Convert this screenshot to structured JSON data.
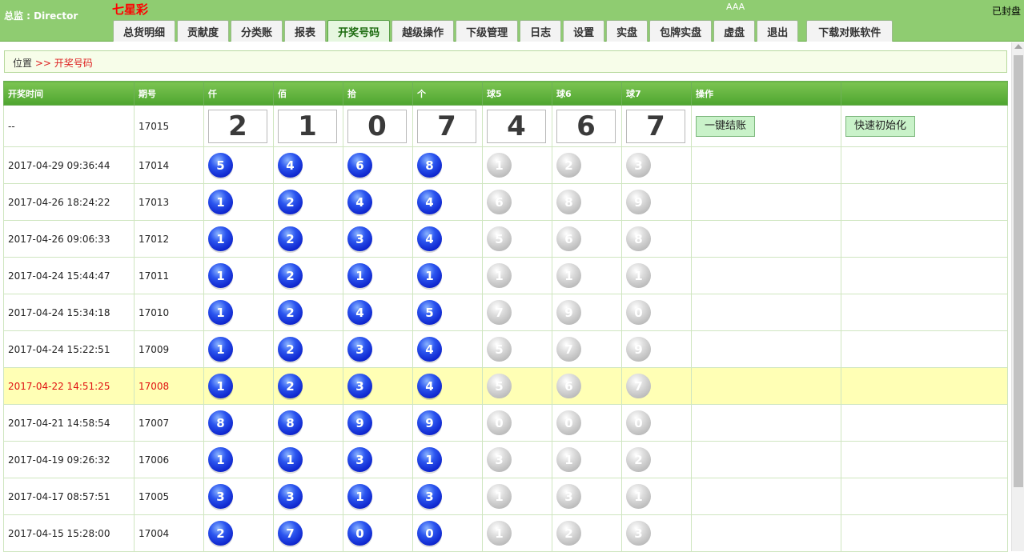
{
  "header": {
    "user_label": "总监 : Director",
    "brand": "七星彩",
    "account": "AAA",
    "status": "已封盘",
    "tabs": [
      "总货明细",
      "贡献度",
      "分类账",
      "报表",
      "开奖号码",
      "越级操作",
      "下级管理",
      "日志",
      "设置",
      "实盘",
      "包牌实盘",
      "虚盘",
      "退出"
    ],
    "download": "下载对账软件",
    "active_tab": "开奖号码"
  },
  "breadcrumb": {
    "label": "位置",
    "current": ">> 开奖号码"
  },
  "table": {
    "headers": [
      "开奖时间",
      "期号",
      "仟",
      "佰",
      "拾",
      "个",
      "球5",
      "球6",
      "球7",
      "操作",
      ""
    ],
    "current": {
      "time": "--",
      "issue": "17015",
      "digits": [
        "2",
        "1",
        "0",
        "7",
        "4",
        "6",
        "7"
      ],
      "btn_settle": "一键结账",
      "btn_init": "快速初始化"
    },
    "rows": [
      {
        "time": "2017-04-29 09:36:44",
        "issue": "17014",
        "balls": [
          "5",
          "4",
          "6",
          "8",
          "1",
          "2",
          "3"
        ]
      },
      {
        "time": "2017-04-26 18:24:22",
        "issue": "17013",
        "balls": [
          "1",
          "2",
          "4",
          "4",
          "6",
          "8",
          "9"
        ]
      },
      {
        "time": "2017-04-26 09:06:33",
        "issue": "17012",
        "balls": [
          "1",
          "2",
          "3",
          "4",
          "5",
          "6",
          "8"
        ]
      },
      {
        "time": "2017-04-24 15:44:47",
        "issue": "17011",
        "balls": [
          "1",
          "2",
          "1",
          "1",
          "1",
          "1",
          "1"
        ]
      },
      {
        "time": "2017-04-24 15:34:18",
        "issue": "17010",
        "balls": [
          "1",
          "2",
          "4",
          "5",
          "7",
          "9",
          "0"
        ]
      },
      {
        "time": "2017-04-24 15:22:51",
        "issue": "17009",
        "balls": [
          "1",
          "2",
          "3",
          "4",
          "5",
          "7",
          "9"
        ]
      },
      {
        "time": "2017-04-22 14:51:25",
        "issue": "17008",
        "balls": [
          "1",
          "2",
          "3",
          "4",
          "5",
          "6",
          "7"
        ],
        "highlight": true
      },
      {
        "time": "2017-04-21 14:58:54",
        "issue": "17007",
        "balls": [
          "8",
          "8",
          "9",
          "9",
          "0",
          "0",
          "0"
        ]
      },
      {
        "time": "2017-04-19 09:26:32",
        "issue": "17006",
        "balls": [
          "1",
          "1",
          "3",
          "1",
          "3",
          "1",
          "2"
        ]
      },
      {
        "time": "2017-04-17 08:57:51",
        "issue": "17005",
        "balls": [
          "3",
          "3",
          "1",
          "3",
          "1",
          "3",
          "1"
        ]
      },
      {
        "time": "2017-04-15 15:28:00",
        "issue": "17004",
        "balls": [
          "2",
          "7",
          "0",
          "0",
          "1",
          "2",
          "3"
        ]
      }
    ]
  },
  "colors": {
    "header_bg": "#8fcc71",
    "table_header": "#5aac3a",
    "highlight_row": "#ffffb5",
    "highlight_text": "#e01010",
    "main_ball": "#1530e0",
    "extra_ball": "#c0c0c0"
  }
}
